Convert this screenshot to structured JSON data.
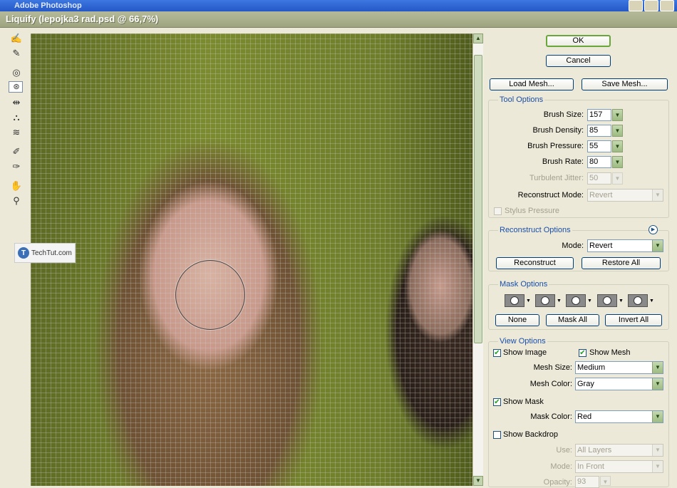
{
  "background_app": {
    "title": "Adobe Photoshop"
  },
  "window": {
    "title": "Liquify (lepojka3 rad.psd @ 66,7%)"
  },
  "tools": [
    {
      "name": "forward-warp-tool-icon",
      "glyph": "✍"
    },
    {
      "name": "reconstruct-tool-icon",
      "glyph": "✎"
    },
    {
      "name": "twirl-clockwise-tool-icon",
      "glyph": "◎"
    },
    {
      "name": "pucker-tool-icon",
      "glyph": "⊛"
    },
    {
      "name": "bloat-tool-icon",
      "glyph": "◈"
    },
    {
      "name": "push-left-tool-icon",
      "glyph": "⇹"
    },
    {
      "name": "mirror-tool-icon",
      "glyph": "⛬"
    },
    {
      "name": "turbulence-tool-icon",
      "glyph": "≋"
    },
    {
      "name": "freeze-mask-tool-icon",
      "glyph": "✐"
    },
    {
      "name": "thaw-mask-tool-icon",
      "glyph": "✑"
    },
    {
      "name": "hand-tool-icon",
      "glyph": "✋"
    },
    {
      "name": "zoom-tool-icon",
      "glyph": "⚲"
    }
  ],
  "watermark": {
    "text": "TechTut.com",
    "logo_letter": "T"
  },
  "buttons": {
    "ok": "OK",
    "cancel": "Cancel",
    "load_mesh": "Load Mesh...",
    "save_mesh": "Save Mesh..."
  },
  "tool_options": {
    "title": "Tool Options",
    "brush_size": {
      "label": "Brush Size:",
      "value": "157"
    },
    "brush_density": {
      "label": "Brush Density:",
      "value": "85"
    },
    "brush_pressure": {
      "label": "Brush Pressure:",
      "value": "55"
    },
    "brush_rate": {
      "label": "Brush Rate:",
      "value": "80"
    },
    "turbulent_jitter": {
      "label": "Turbulent Jitter:",
      "value": "50"
    },
    "reconstruct_mode": {
      "label": "Reconstruct Mode:",
      "value": "Revert"
    },
    "stylus_pressure": {
      "label": "Stylus Pressure",
      "checked": false
    }
  },
  "reconstruct_options": {
    "title": "Reconstruct Options",
    "mode_label": "Mode:",
    "mode_value": "Revert",
    "reconstruct": "Reconstruct",
    "restore_all": "Restore All"
  },
  "mask_options": {
    "title": "Mask Options",
    "none": "None",
    "mask_all": "Mask All",
    "invert_all": "Invert All"
  },
  "view_options": {
    "title": "View Options",
    "show_image": {
      "label": "Show Image",
      "checked": true
    },
    "show_mesh": {
      "label": "Show Mesh",
      "checked": true
    },
    "mesh_size": {
      "label": "Mesh Size:",
      "value": "Medium"
    },
    "mesh_color": {
      "label": "Mesh Color:",
      "value": "Gray"
    },
    "show_mask": {
      "label": "Show Mask",
      "checked": true
    },
    "mask_color": {
      "label": "Mask Color:",
      "value": "Red"
    },
    "show_backdrop": {
      "label": "Show Backdrop",
      "checked": false
    },
    "use": {
      "label": "Use:",
      "value": "All Layers"
    },
    "mode": {
      "label": "Mode:",
      "value": "In Front"
    },
    "opacity": {
      "label": "Opacity:",
      "value": "93"
    }
  },
  "colors": {
    "accent_green": "#6aa73a",
    "group_title_blue": "#1a4ea8",
    "dialog_bg": "#ece9d8"
  }
}
